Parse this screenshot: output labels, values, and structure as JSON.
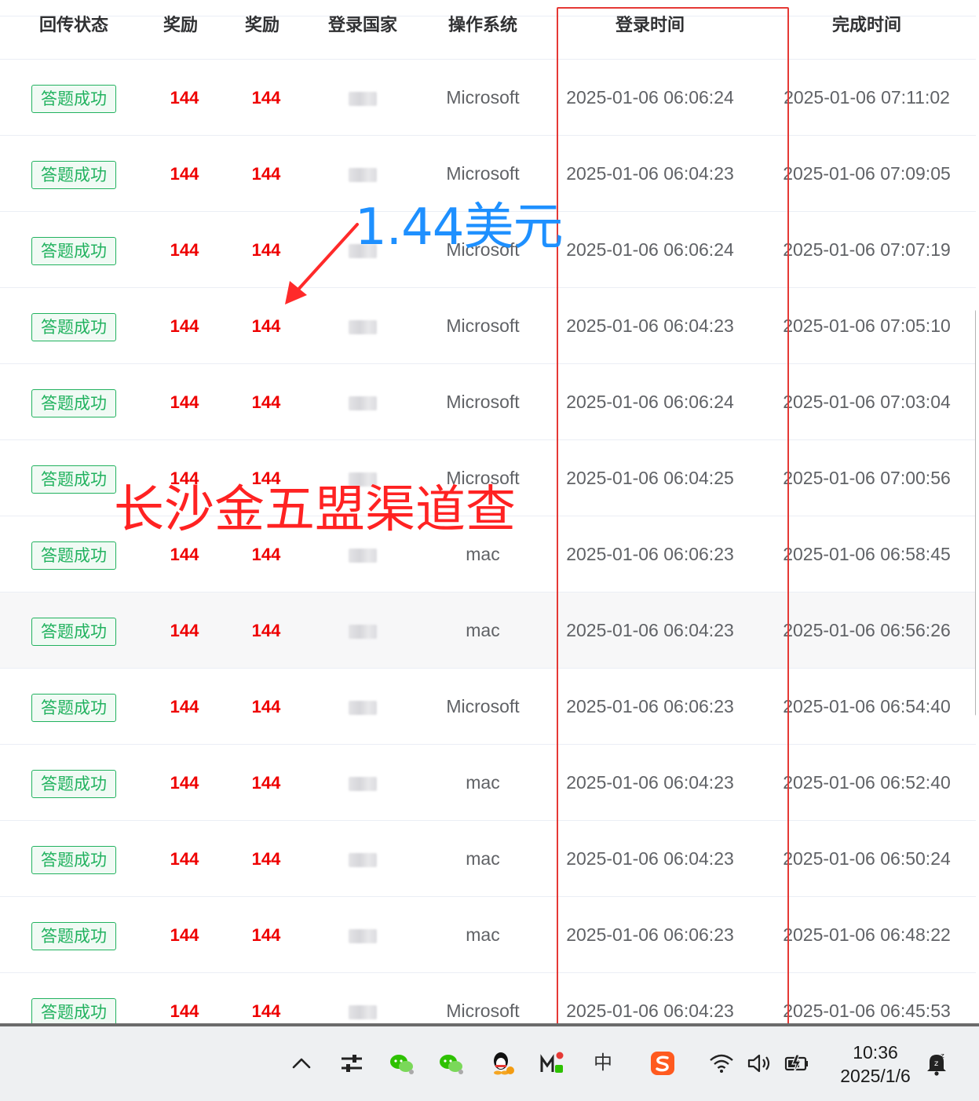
{
  "table": {
    "headers": {
      "status": "回传状态",
      "reward1": "奖励",
      "reward2": "奖励",
      "country": "登录国家",
      "os": "操作系统",
      "login_time": "登录时间",
      "finish_time": "完成时间"
    },
    "rows": [
      {
        "status": "答题成功",
        "reward1": "144",
        "reward2": "144",
        "os": "Microsoft",
        "login": "2025-01-06 06:06:24",
        "done": "2025-01-06 07:11:02"
      },
      {
        "status": "答题成功",
        "reward1": "144",
        "reward2": "144",
        "os": "Microsoft",
        "login": "2025-01-06 06:04:23",
        "done": "2025-01-06 07:09:05"
      },
      {
        "status": "答题成功",
        "reward1": "144",
        "reward2": "144",
        "os": "Microsoft",
        "login": "2025-01-06 06:06:24",
        "done": "2025-01-06 07:07:19"
      },
      {
        "status": "答题成功",
        "reward1": "144",
        "reward2": "144",
        "os": "Microsoft",
        "login": "2025-01-06 06:04:23",
        "done": "2025-01-06 07:05:10"
      },
      {
        "status": "答题成功",
        "reward1": "144",
        "reward2": "144",
        "os": "Microsoft",
        "login": "2025-01-06 06:06:24",
        "done": "2025-01-06 07:03:04"
      },
      {
        "status": "答题成功",
        "reward1": "144",
        "reward2": "144",
        "os": "Microsoft",
        "login": "2025-01-06 06:04:25",
        "done": "2025-01-06 07:00:56"
      },
      {
        "status": "答题成功",
        "reward1": "144",
        "reward2": "144",
        "os": "mac",
        "login": "2025-01-06 06:06:23",
        "done": "2025-01-06 06:58:45"
      },
      {
        "status": "答题成功",
        "reward1": "144",
        "reward2": "144",
        "os": "mac",
        "login": "2025-01-06 06:04:23",
        "done": "2025-01-06 06:56:26"
      },
      {
        "status": "答题成功",
        "reward1": "144",
        "reward2": "144",
        "os": "Microsoft",
        "login": "2025-01-06 06:06:23",
        "done": "2025-01-06 06:54:40"
      },
      {
        "status": "答题成功",
        "reward1": "144",
        "reward2": "144",
        "os": "mac",
        "login": "2025-01-06 06:04:23",
        "done": "2025-01-06 06:52:40"
      },
      {
        "status": "答题成功",
        "reward1": "144",
        "reward2": "144",
        "os": "mac",
        "login": "2025-01-06 06:04:23",
        "done": "2025-01-06 06:50:24"
      },
      {
        "status": "答题成功",
        "reward1": "144",
        "reward2": "144",
        "os": "mac",
        "login": "2025-01-06 06:06:23",
        "done": "2025-01-06 06:48:22"
      },
      {
        "status": "答题成功",
        "reward1": "144",
        "reward2": "144",
        "os": "Microsoft",
        "login": "2025-01-06 06:04:23",
        "done": "2025-01-06 06:45:53"
      }
    ]
  },
  "annotations": {
    "usd": "1.44美元",
    "caption": "长沙金五盟渠道查"
  },
  "taskbar": {
    "icons": [
      "chevron-up-icon",
      "sliders-icon",
      "wechat-icon",
      "wechat-icon",
      "qq-icon",
      "app-icon",
      "ime-icon",
      "sogou-icon",
      "wifi-icon",
      "volume-icon",
      "battery-icon",
      "notification-icon"
    ],
    "ime_label": "中",
    "time": "10:36",
    "date": "2025/1/6"
  },
  "colors": {
    "success": "#22b25f",
    "reward": "#ee0000",
    "highlight_box": "#e53935",
    "usd_annotation": "#1e90ff",
    "caption_annotation": "#ff2222"
  }
}
